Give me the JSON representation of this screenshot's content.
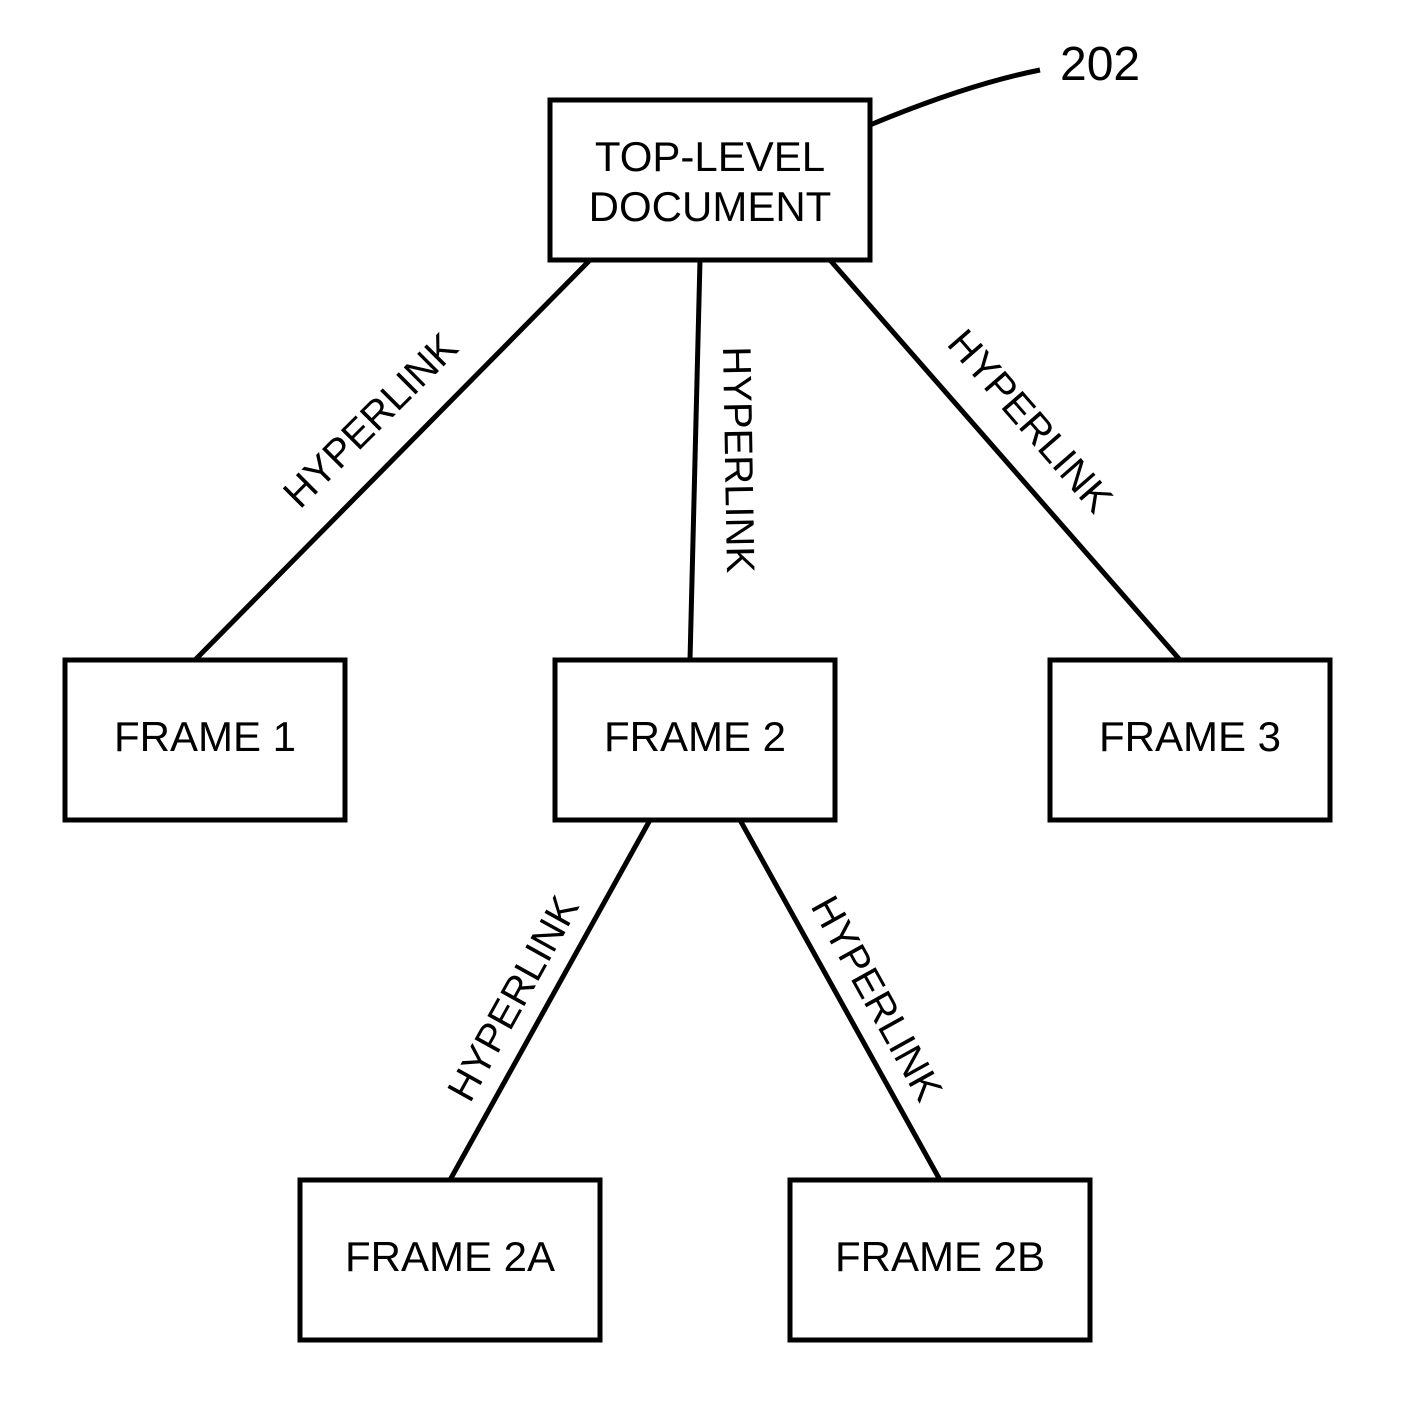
{
  "reference": {
    "num": "202"
  },
  "nodes": {
    "root": {
      "line1": "TOP-LEVEL",
      "line2": "DOCUMENT"
    },
    "f1": "FRAME 1",
    "f2": "FRAME 2",
    "f3": "FRAME 3",
    "f2a": "FRAME 2A",
    "f2b": "FRAME 2B"
  },
  "edge_label": "HYPERLINK"
}
